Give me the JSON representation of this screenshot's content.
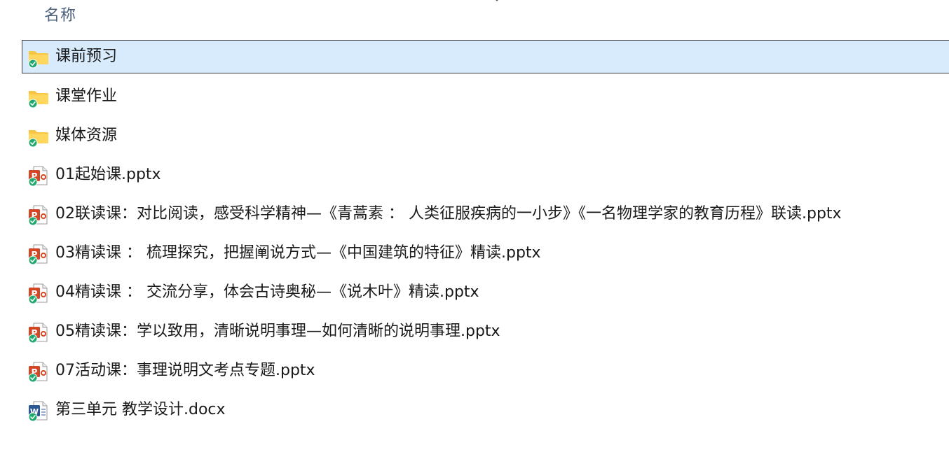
{
  "header": {
    "name_column": "名称"
  },
  "colors": {
    "selected_bg": "#d7ebfc",
    "folder": "#f6c644",
    "ppt": "#d24726",
    "word": "#2b5797",
    "sync_check": "#1fa96d"
  },
  "files": [
    {
      "name": "课前预习",
      "type": "folder",
      "icon": "folder-icon",
      "selected": true
    },
    {
      "name": "课堂作业",
      "type": "folder",
      "icon": "folder-icon",
      "selected": false
    },
    {
      "name": "媒体资源",
      "type": "folder",
      "icon": "folder-icon",
      "selected": false
    },
    {
      "name": "01起始课.pptx",
      "type": "pptx",
      "icon": "powerpoint-icon",
      "selected": false
    },
    {
      "name": "02联读课：对比阅读，感受科学精神—《青蒿素 ： 人类征服疾病的一小步》《一名物理学家的教育历程》联读.pptx",
      "type": "pptx",
      "icon": "powerpoint-icon",
      "selected": false
    },
    {
      "name": "03精读课 ： 梳理探究，把握阐说方式—《中国建筑的特征》精读.pptx",
      "type": "pptx",
      "icon": "powerpoint-icon",
      "selected": false
    },
    {
      "name": "04精读课 ： 交流分享，体会古诗奥秘—《说木叶》精读.pptx",
      "type": "pptx",
      "icon": "powerpoint-icon",
      "selected": false
    },
    {
      "name": "05精读课：学以致用，清晰说明事理—如何清晰的说明事理.pptx",
      "type": "pptx",
      "icon": "powerpoint-icon",
      "selected": false
    },
    {
      "name": "07活动课：事理说明文考点专题.pptx",
      "type": "pptx",
      "icon": "powerpoint-icon",
      "selected": false
    },
    {
      "name": "第三单元 教学设计.docx",
      "type": "docx",
      "icon": "word-icon",
      "selected": false
    }
  ]
}
